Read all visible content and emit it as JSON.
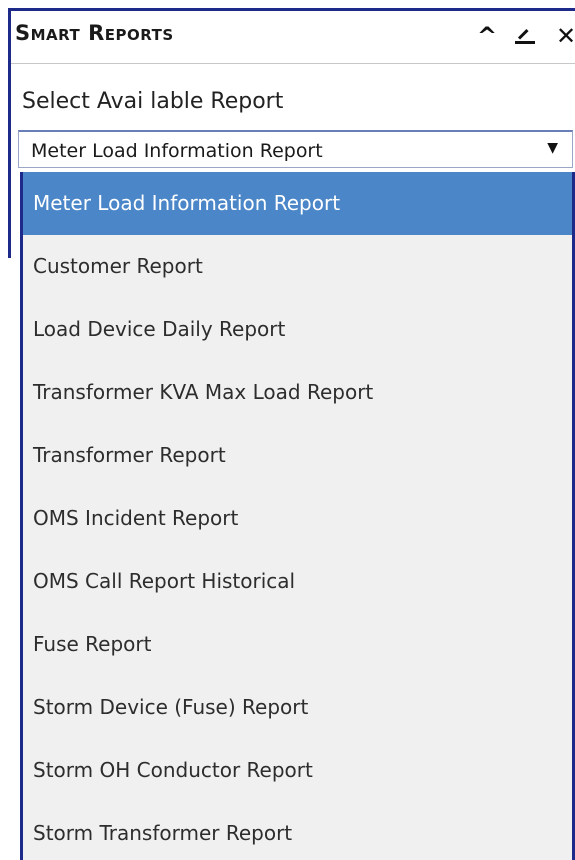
{
  "panel": {
    "title": "Smart Reports",
    "icons": {
      "collapse": "chevron-up-icon",
      "dock": "dock-icon",
      "close": "close-icon"
    }
  },
  "form": {
    "label": "Select Avai lable Report",
    "selected_value": "Meter Load Information Report",
    "arrow_glyph": "▼"
  },
  "dropdown": {
    "items": [
      "Meter Load Information Report",
      "Customer Report",
      "Load Device Daily Report",
      "Transformer KVA Max Load Report",
      "Transformer Report",
      "OMS Incident Report",
      "OMS Call Report Historical",
      "Fuse Report",
      "Storm Device (Fuse) Report",
      "Storm OH Conductor Report",
      "Storm Transformer Report"
    ],
    "selected_index": 0
  },
  "colors": {
    "frame": "#1d2a8a",
    "highlight": "#4a86c8",
    "list_bg": "#f0f0f0"
  }
}
